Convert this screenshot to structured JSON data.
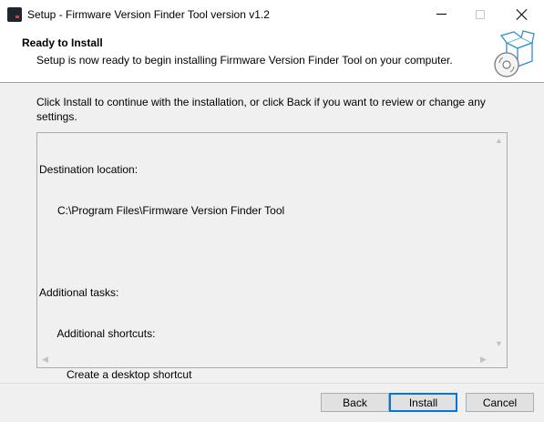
{
  "window": {
    "title": "Setup - Firmware Version Finder Tool version v1.2",
    "controls": {
      "minimize": "minimize-icon",
      "maximize": "maximize-icon",
      "close": "close-icon"
    }
  },
  "header": {
    "title": "Ready to Install",
    "subtitle": "Setup is now ready to begin installing Firmware Version Finder Tool on your computer.",
    "art_icon": "install-box-disc-icon"
  },
  "body": {
    "intro": "Click Install to continue with the installation, or click Back if you want to review or change any settings.",
    "memo_lines": [
      "Destination location:",
      "      C:\\Program Files\\Firmware Version Finder Tool",
      "",
      "Additional tasks:",
      "      Additional shortcuts:",
      "         Create a desktop shortcut"
    ]
  },
  "buttons": {
    "back": "Back",
    "install": "Install",
    "cancel": "Cancel"
  },
  "colors": {
    "accent": "#0078d7",
    "header_bg": "#ffffff",
    "dialog_bg": "#f0f0f0"
  }
}
